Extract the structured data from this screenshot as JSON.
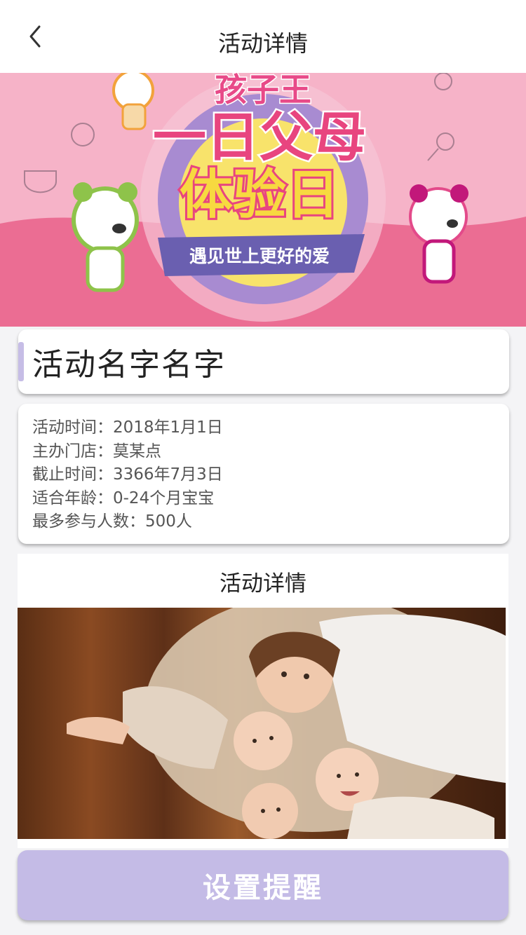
{
  "navbar": {
    "title": "活动详情",
    "back_icon": "chevron-left-icon"
  },
  "banner": {
    "line1": "孩子王",
    "line2": "一日父母",
    "line3": "体验日",
    "ribbon": "遇见世上更好的爱",
    "colors": {
      "bg": "#f6b3c8",
      "ground": "#eb6d93",
      "ribbon": "#6a5fb0",
      "circle": "#f8e36b"
    }
  },
  "activity": {
    "name": "活动名字名字"
  },
  "info": {
    "rows": [
      "活动时间：2018年1月1日",
      "主办门店：莫某点",
      "截止时间：3366年7月3日",
      "适合年龄：0-24个月宝宝",
      "最多参与人数：500人"
    ]
  },
  "detail": {
    "title": "活动详情",
    "photo": "children-lying-photo"
  },
  "action": {
    "remind_label": "设置提醒",
    "color": "#c4bbe6"
  }
}
